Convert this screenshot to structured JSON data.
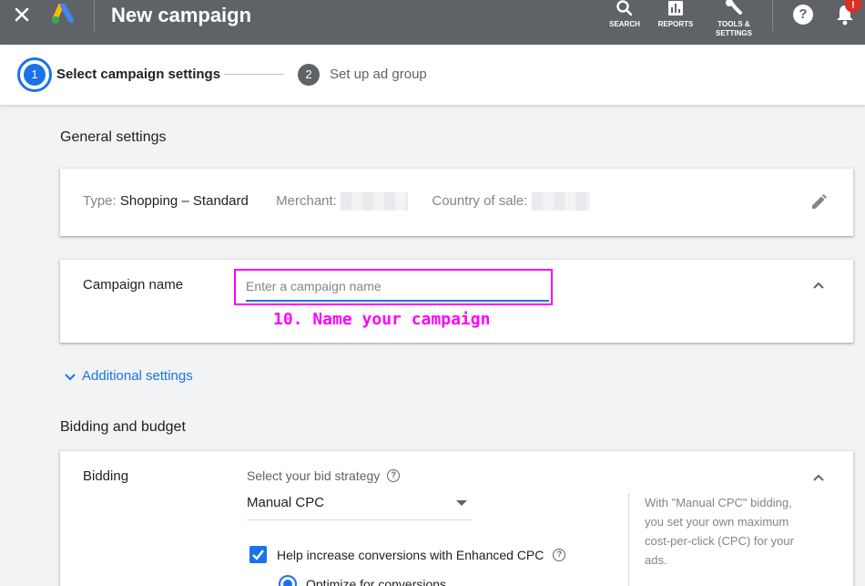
{
  "header": {
    "title": "New campaign",
    "tools": [
      {
        "label": "SEARCH",
        "icon": "search-icon"
      },
      {
        "label": "REPORTS",
        "icon": "reports-icon"
      },
      {
        "label_line1": "TOOLS &",
        "label_line2": "SETTINGS",
        "icon": "wrench-icon"
      }
    ],
    "help_glyph": "?",
    "notification_badge": "!"
  },
  "stepper": {
    "steps": [
      {
        "number": "1",
        "label": "Select campaign settings",
        "state": "active"
      },
      {
        "number": "2",
        "label": "Set up ad group",
        "state": "upcoming"
      }
    ]
  },
  "general_settings": {
    "heading": "General settings",
    "type_label": "Type:",
    "type_value": "Shopping – Standard",
    "merchant_label": "Merchant:",
    "country_label": "Country of sale:"
  },
  "campaign_name": {
    "label": "Campaign name",
    "value": "",
    "placeholder": "Enter a campaign name",
    "annotation": "10. Name your campaign"
  },
  "additional_settings": {
    "label": "Additional settings"
  },
  "bidding_budget": {
    "heading": "Bidding and budget",
    "bidding_label": "Bidding",
    "strategy_label": "Select your bid strategy",
    "strategy_value": "Manual CPC",
    "help_text": "With \"Manual CPC\" bidding, you set your own maximum cost-per-click (CPC) for your ads.",
    "ecpc_label": "Help increase conversions with Enhanced CPC",
    "ecpc_checked": true,
    "option_label": "Optimize for conversions"
  },
  "colors": {
    "topbar": "#5f6368",
    "accent": "#1a73e8",
    "annotation": "#ff00ff",
    "alert": "#d93025"
  }
}
